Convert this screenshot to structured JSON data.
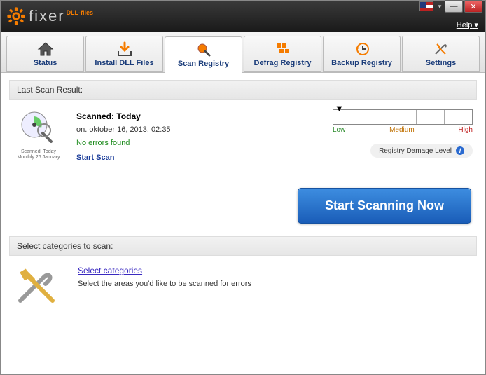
{
  "titlebar": {
    "brand": "fixer",
    "badge": "DLL-files",
    "help": "Help"
  },
  "tabs": [
    {
      "label": "Status"
    },
    {
      "label": "Install DLL Files"
    },
    {
      "label": "Scan Registry"
    },
    {
      "label": "Defrag Registry"
    },
    {
      "label": "Backup Registry"
    },
    {
      "label": "Settings"
    }
  ],
  "section1": {
    "header": "Last Scan Result:",
    "scanned_label": "Scanned: Today",
    "scanned_date": "on. oktober 16, 2013. 02:35",
    "no_errors": "No errors found",
    "start_scan": "Start Scan",
    "icon_sub": "Scanned: Today\nMonthly 26 January"
  },
  "gauge": {
    "low": "Low",
    "medium": "Medium",
    "high": "High",
    "damage_label": "Registry Damage Level"
  },
  "big_button": "Start Scanning Now",
  "section2": {
    "header": "Select categories to scan:",
    "link": "Select categories",
    "desc": "Select the areas you'd like to be scanned for errors"
  }
}
